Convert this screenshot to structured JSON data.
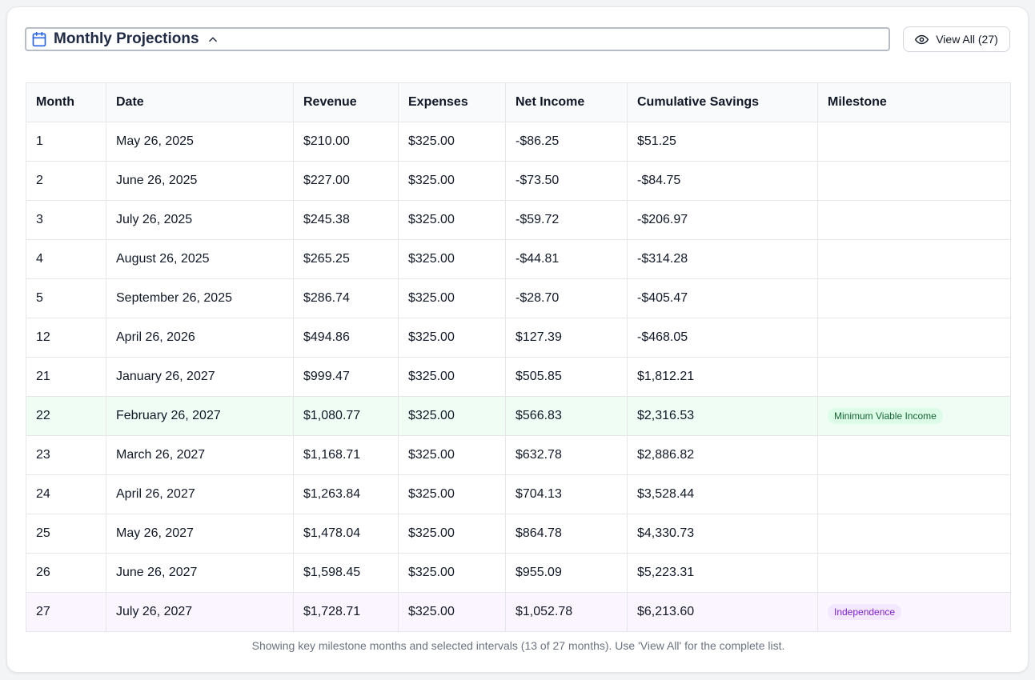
{
  "header": {
    "title": "Monthly Projections",
    "view_all_label": "View All (27)"
  },
  "colors": {
    "accent": "#2563eb",
    "milestone_green_bg": "#dcfce7",
    "milestone_green_text": "#166534",
    "milestone_purple_bg": "#f3e8ff",
    "milestone_purple_text": "#7e22ce"
  },
  "icons": {
    "title_icon": "calendar-icon",
    "toggle_icon": "chevron-up-icon",
    "view_all_icon": "eye-icon"
  },
  "table": {
    "columns": [
      "Month",
      "Date",
      "Revenue",
      "Expenses",
      "Net Income",
      "Cumulative Savings",
      "Milestone"
    ],
    "rows": [
      {
        "month": "1",
        "date": "May 26, 2025",
        "revenue": "$210.00",
        "expenses": "$325.00",
        "net": "-$86.25",
        "savings": "$51.25",
        "milestone": ""
      },
      {
        "month": "2",
        "date": "June 26, 2025",
        "revenue": "$227.00",
        "expenses": "$325.00",
        "net": "-$73.50",
        "savings": "-$84.75",
        "milestone": ""
      },
      {
        "month": "3",
        "date": "July 26, 2025",
        "revenue": "$245.38",
        "expenses": "$325.00",
        "net": "-$59.72",
        "savings": "-$206.97",
        "milestone": ""
      },
      {
        "month": "4",
        "date": "August 26, 2025",
        "revenue": "$265.25",
        "expenses": "$325.00",
        "net": "-$44.81",
        "savings": "-$314.28",
        "milestone": ""
      },
      {
        "month": "5",
        "date": "September 26, 2025",
        "revenue": "$286.74",
        "expenses": "$325.00",
        "net": "-$28.70",
        "savings": "-$405.47",
        "milestone": ""
      },
      {
        "month": "12",
        "date": "April 26, 2026",
        "revenue": "$494.86",
        "expenses": "$325.00",
        "net": "$127.39",
        "savings": "-$468.05",
        "milestone": ""
      },
      {
        "month": "21",
        "date": "January 26, 2027",
        "revenue": "$999.47",
        "expenses": "$325.00",
        "net": "$505.85",
        "savings": "$1,812.21",
        "milestone": ""
      },
      {
        "month": "22",
        "date": "February 26, 2027",
        "revenue": "$1,080.77",
        "expenses": "$325.00",
        "net": "$566.83",
        "savings": "$2,316.53",
        "milestone": "Minimum Viable Income"
      },
      {
        "month": "23",
        "date": "March 26, 2027",
        "revenue": "$1,168.71",
        "expenses": "$325.00",
        "net": "$632.78",
        "savings": "$2,886.82",
        "milestone": ""
      },
      {
        "month": "24",
        "date": "April 26, 2027",
        "revenue": "$1,263.84",
        "expenses": "$325.00",
        "net": "$704.13",
        "savings": "$3,528.44",
        "milestone": ""
      },
      {
        "month": "25",
        "date": "May 26, 2027",
        "revenue": "$1,478.04",
        "expenses": "$325.00",
        "net": "$864.78",
        "savings": "$4,330.73",
        "milestone": ""
      },
      {
        "month": "26",
        "date": "June 26, 2027",
        "revenue": "$1,598.45",
        "expenses": "$325.00",
        "net": "$955.09",
        "savings": "$5,223.31",
        "milestone": ""
      },
      {
        "month": "27",
        "date": "July 26, 2027",
        "revenue": "$1,728.71",
        "expenses": "$325.00",
        "net": "$1,052.78",
        "savings": "$6,213.60",
        "milestone": "Independence"
      }
    ]
  },
  "footer": {
    "note": "Showing key milestone months and selected intervals (13 of 27 months). Use 'View All' for the complete list."
  }
}
